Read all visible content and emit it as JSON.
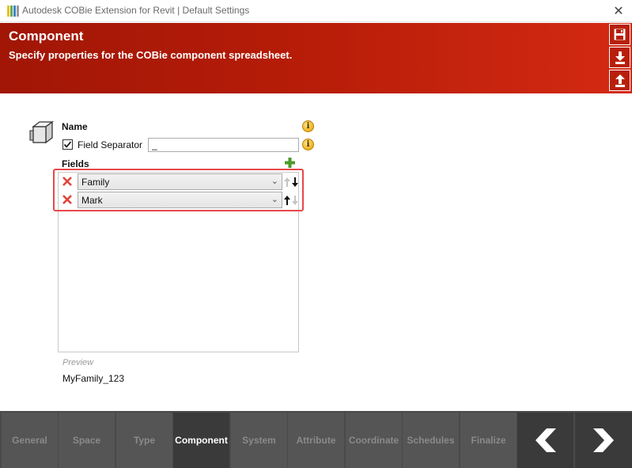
{
  "window": {
    "title": "Autodesk COBie Extension for Revit | Default Settings",
    "close_glyph": "✕"
  },
  "header": {
    "title": "Component",
    "subtitle": "Specify properties for the COBie component spreadsheet.",
    "accent": "#b51c08"
  },
  "form": {
    "name_label": "Name",
    "field_separator_label": "Field Separator",
    "field_separator_checked": true,
    "field_separator_value": "_",
    "fields_label": "Fields",
    "fields": [
      {
        "value": "Family"
      },
      {
        "value": "Mark"
      }
    ],
    "preview_label": "Preview",
    "preview_value": "MyFamily_123"
  },
  "tabs": [
    {
      "label": "General"
    },
    {
      "label": "Space"
    },
    {
      "label": "Type"
    },
    {
      "label": "Component",
      "active": true
    },
    {
      "label": "System"
    },
    {
      "label": "Attribute"
    },
    {
      "label": "Coordinate"
    },
    {
      "label": "Schedules"
    },
    {
      "label": "Finalize"
    }
  ],
  "icons": {
    "info": "i",
    "chevron": "⌄"
  }
}
